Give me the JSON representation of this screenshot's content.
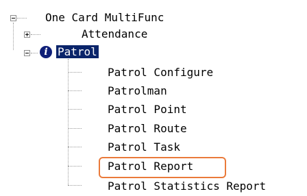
{
  "tree": {
    "root": {
      "label": "One Card MultiFunc",
      "state": "expanded"
    },
    "attendance": {
      "label": "Attendance",
      "state": "collapsed"
    },
    "patrol": {
      "label": "Patrol",
      "state": "expanded",
      "icon": "info-icon",
      "children": [
        "Patrol Configure",
        "Patrolman",
        "Patrol Point",
        "Patrol Route",
        "Patrol Task",
        "Patrol Report",
        "Patrol Statistics Report"
      ]
    }
  },
  "highlight": {
    "target": "Patrol Report",
    "color": "#ea7a3a"
  },
  "colors": {
    "selection": "#0a246a",
    "icon": "#0f1f78"
  }
}
